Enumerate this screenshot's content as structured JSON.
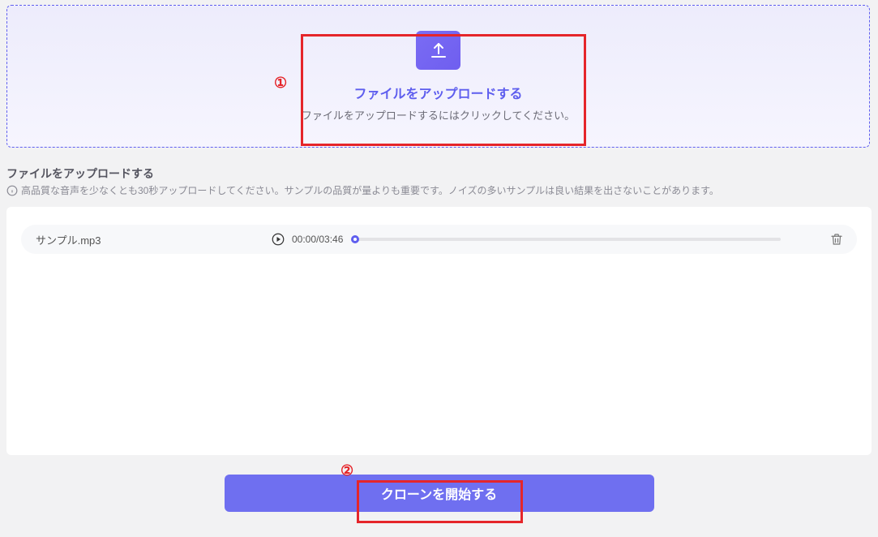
{
  "annotations": {
    "step1": "①",
    "step2": "②"
  },
  "upload_area": {
    "title": "ファイルをアップロードする",
    "subtitle": "ファイルをアップロードするにはクリックしてください。"
  },
  "section": {
    "label": "ファイルをアップロードする",
    "help_text": "高品質な音声を少なくとも30秒アップロードしてください。サンプルの品質が量よりも重要です。ノイズの多いサンプルは良い結果を出さないことがあります。"
  },
  "file": {
    "name": "サンプル.mp3",
    "current_time": "00:00",
    "duration": "03:46"
  },
  "start_button": {
    "label": "クローンを開始する"
  },
  "colors": {
    "accent": "#5f5eef",
    "highlight": "#e5252a"
  }
}
